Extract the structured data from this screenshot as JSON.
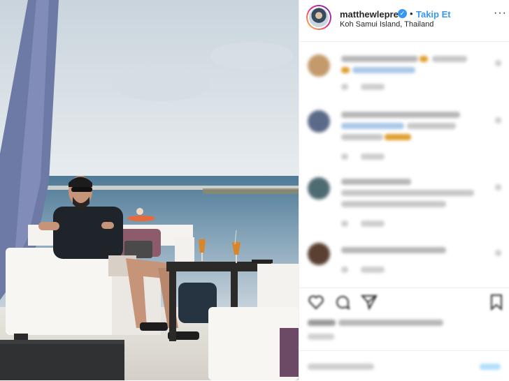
{
  "post": {
    "username": "matthewlepre",
    "verified_mark": "✓",
    "separator": "•",
    "follow_label": "Takip Et",
    "location": "Koh Samui Island, Thailand",
    "more_label": "···"
  },
  "icons": {
    "verified": "verified-badge-icon",
    "more": "more-options-icon",
    "like": "heart-icon",
    "comment": "comment-bubble-icon",
    "share": "share-plane-icon",
    "save": "bookmark-icon"
  },
  "colors": {
    "accent": "#3897f0",
    "text": "#262626",
    "muted": "#8e8e8e",
    "border": "#efefef"
  }
}
